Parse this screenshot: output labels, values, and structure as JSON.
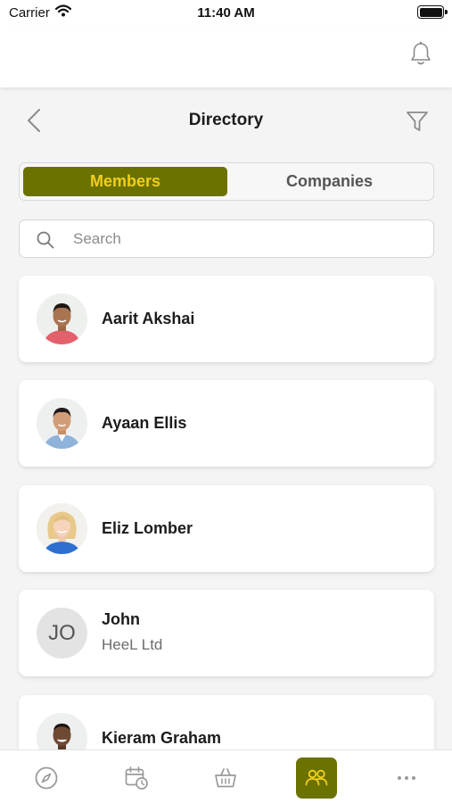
{
  "status_bar": {
    "carrier": "Carrier",
    "time": "11:40 AM"
  },
  "header": {
    "title": "Directory"
  },
  "tabs": [
    {
      "label": "Members",
      "active": true
    },
    {
      "label": "Companies",
      "active": false
    }
  ],
  "search": {
    "placeholder": "Search",
    "value": ""
  },
  "members": [
    {
      "name": "Aarit Akshai"
    },
    {
      "name": "Ayaan Ellis"
    },
    {
      "name": "Eliz Lomber"
    },
    {
      "name": "John",
      "company": "HeeL Ltd",
      "initials": "JO"
    },
    {
      "name": "Kieram Graham"
    }
  ],
  "bottom_nav": [
    {
      "icon": "compass-icon",
      "active": false
    },
    {
      "icon": "calendar-clock-icon",
      "active": false
    },
    {
      "icon": "basket-icon",
      "active": false
    },
    {
      "icon": "people-icon",
      "active": true
    },
    {
      "icon": "more-icon",
      "active": false
    }
  ],
  "colors": {
    "accent": "#6b7200",
    "accent_text": "#f2cf1a",
    "background": "#f4f4f4"
  }
}
